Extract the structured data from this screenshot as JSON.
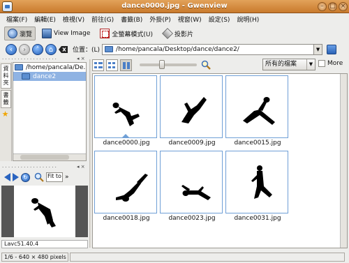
{
  "window": {
    "title": "dance0000.jpg - Gwenview"
  },
  "menu": [
    "檔案(F)",
    "編輯(E)",
    "檢視(V)",
    "前往(G)",
    "書籤(B)",
    "外掛(P)",
    "視窗(W)",
    "設定(S)",
    "說明(H)"
  ],
  "toolbar": {
    "browse_label": "瀏覽",
    "view_image_label": "View Image",
    "fullscreen_label": "全螢幕模式(U)",
    "slideshow_label": "投影片"
  },
  "location": {
    "label": "位置：(L)",
    "path": "/home/pancala/Desktop/dance/dance2/"
  },
  "sidebar": {
    "tabs": [
      "資料夾",
      "書籤"
    ],
    "tree": [
      {
        "label": "/home/pancala/De...",
        "selected": false
      },
      {
        "label": "dance2",
        "selected": true
      }
    ]
  },
  "preview": {
    "zoom_text": "Fit to",
    "more_arrow": "»",
    "comment": "Lavc51.40.4"
  },
  "filter": {
    "selected": "所有的檔案",
    "more_label": "More"
  },
  "thumbnails": [
    {
      "name": "dance0000.jpg",
      "current": true
    },
    {
      "name": "dance0009.jpg",
      "current": false
    },
    {
      "name": "dance0015.jpg",
      "current": false
    },
    {
      "name": "dance0018.jpg",
      "current": false
    },
    {
      "name": "dance0023.jpg",
      "current": false
    },
    {
      "name": "dance0031.jpg",
      "current": false
    }
  ],
  "status": {
    "text": "1/6 - 640 × 480 pixels"
  },
  "colors": {
    "titlebar": "#d08a3e",
    "selection": "#8fb3e3",
    "thumb_border": "#6f9fd6"
  }
}
